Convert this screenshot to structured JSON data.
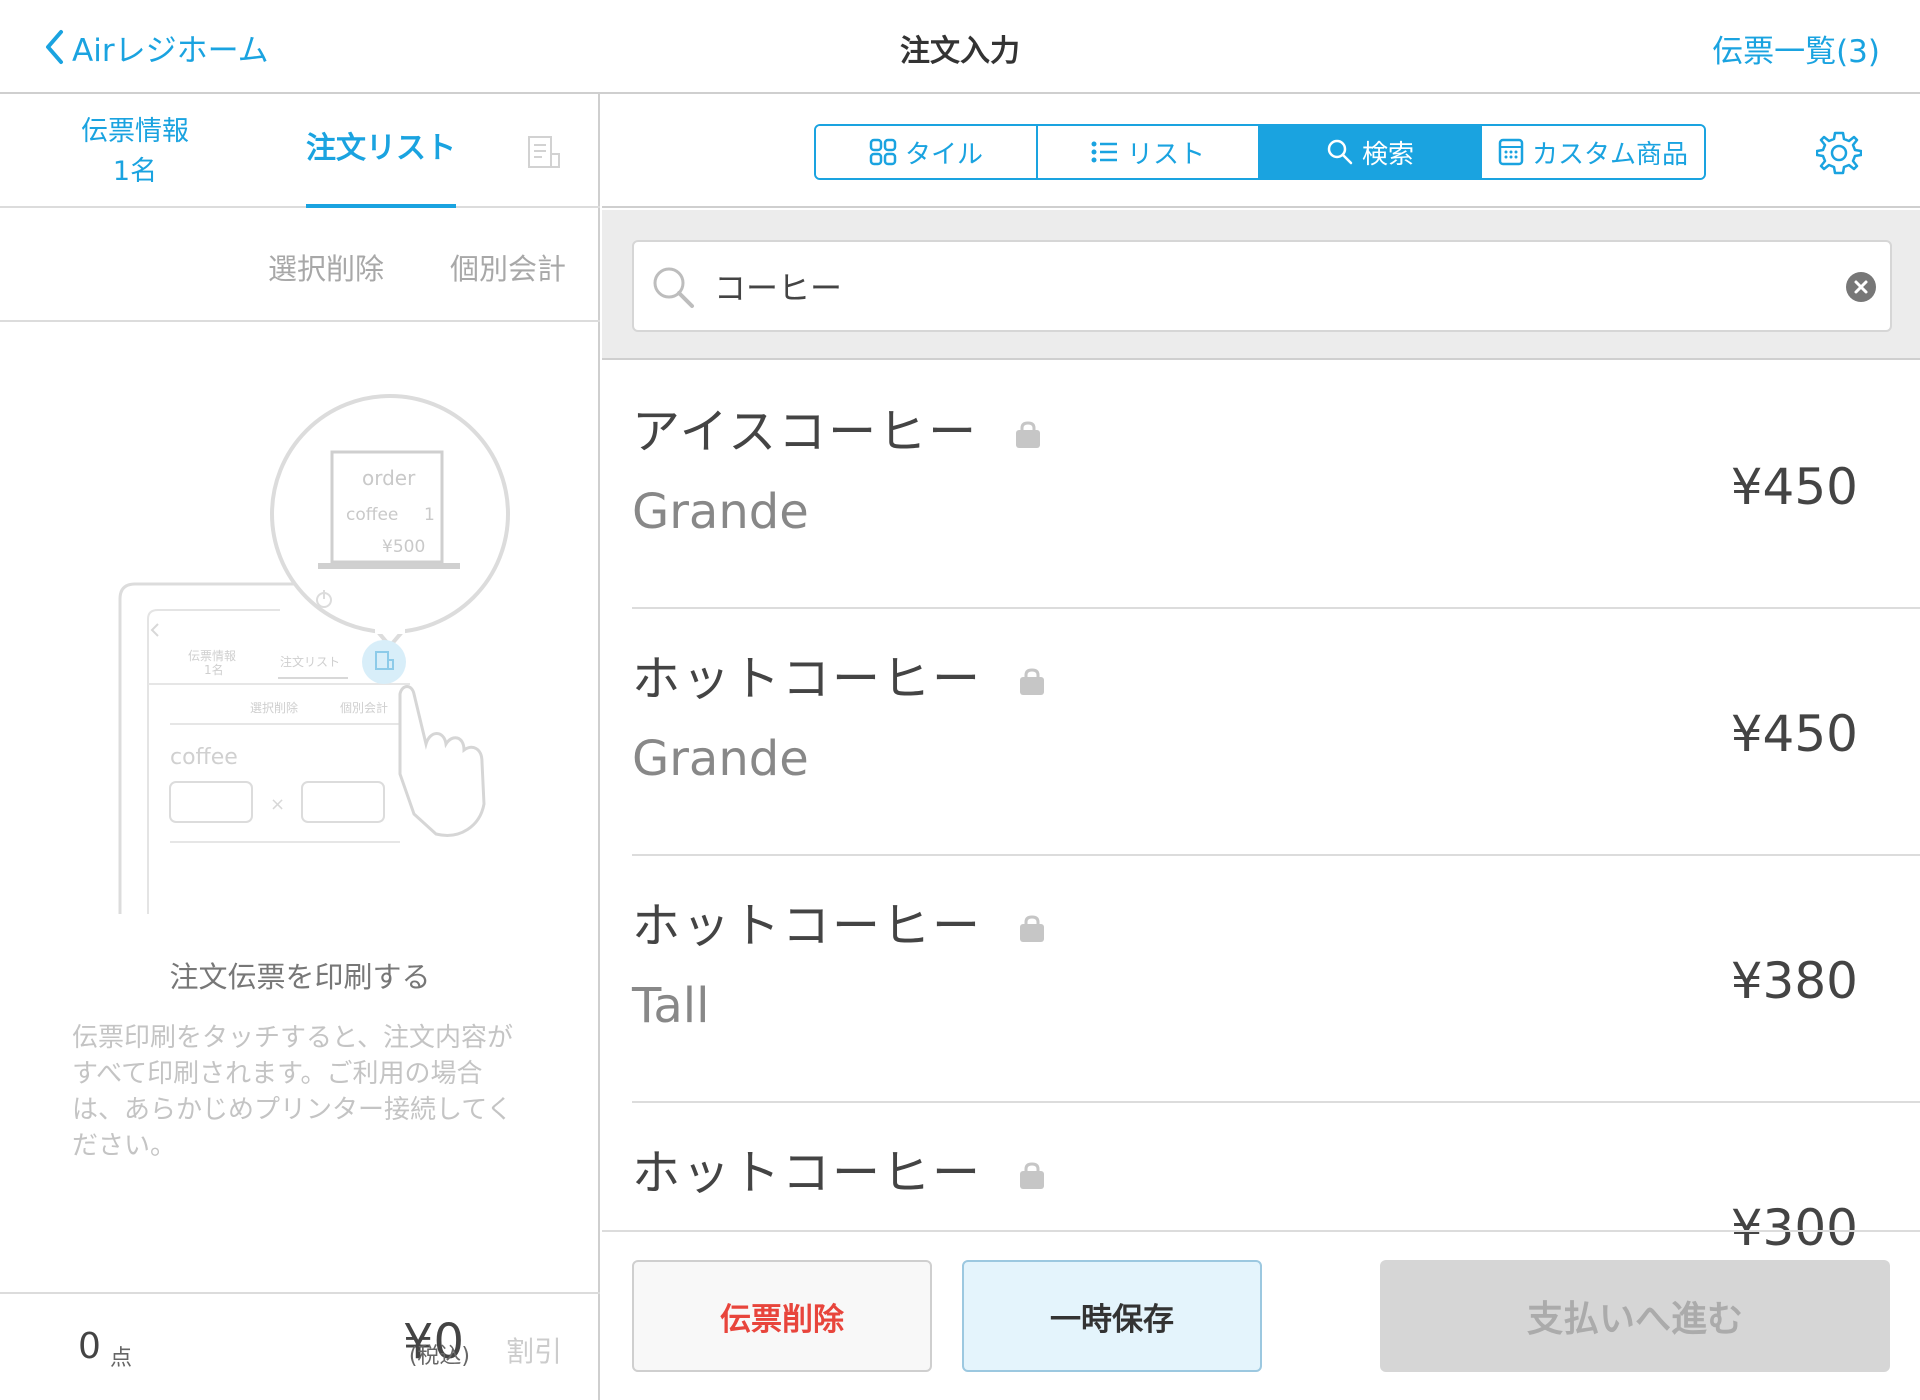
{
  "header": {
    "back_label": "Airレジホーム",
    "title": "注文入力",
    "slips_label": "伝票一覧(3)"
  },
  "left": {
    "tab_info_line1": "伝票情報",
    "tab_info_line2": "1名",
    "tab_orders": "注文リスト",
    "action_delete": "選択削除",
    "action_split": "個別会計",
    "illustration": {
      "receipt_title": "order",
      "receipt_item": "coffee",
      "receipt_qty": "1",
      "receipt_price": "¥500",
      "tablet_tab1": "伝票情報",
      "tablet_tab1_sub": "1名",
      "tablet_tab2": "注文リスト",
      "tablet_action1": "選択削除",
      "tablet_action2": "個別会計",
      "tablet_item": "coffee",
      "tablet_times": "×"
    },
    "empty_title": "注文伝票を印刷する",
    "empty_desc": "伝票印刷をタッチすると、注文内容がすべて印刷されます。ご利用の場合は、あらかじめプリンター接続してください。",
    "footer": {
      "count": "0",
      "count_unit": "点",
      "total": "¥0",
      "tax_note": "(税込)",
      "discount": "割引"
    }
  },
  "toolbar": {
    "tabs": [
      {
        "label": "タイル",
        "icon": "grid-icon"
      },
      {
        "label": "リスト",
        "icon": "list-icon"
      },
      {
        "label": "検索",
        "icon": "search-icon"
      },
      {
        "label": "カスタム商品",
        "icon": "calculator-icon"
      }
    ],
    "active_tab": "検索"
  },
  "search": {
    "value": "コーヒー",
    "placeholder": ""
  },
  "results": [
    {
      "name": "アイスコーヒー",
      "size": "Grande",
      "price": "¥450"
    },
    {
      "name": "ホットコーヒー",
      "size": "Grande",
      "price": "¥450"
    },
    {
      "name": "ホットコーヒー",
      "size": "Tall",
      "price": "¥380"
    },
    {
      "name": "ホットコーヒー",
      "size": "",
      "price": "¥300"
    }
  ],
  "buttons": {
    "delete_slip": "伝票削除",
    "hold": "一時保存",
    "pay": "支払いへ進む"
  },
  "colors": {
    "accent": "#1aa3e0",
    "danger": "#e8453c",
    "disabled": "#d6d6d6"
  }
}
